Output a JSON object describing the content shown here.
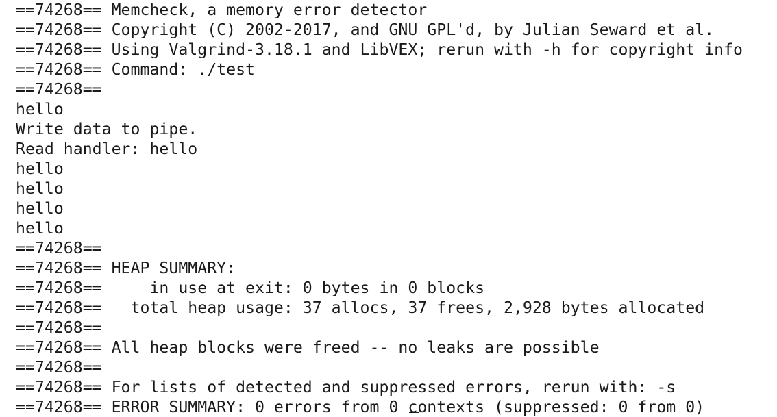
{
  "terminal": {
    "lines": [
      "==74268== Memcheck, a memory error detector",
      "==74268== Copyright (C) 2002-2017, and GNU GPL'd, by Julian Seward et al.",
      "==74268== Using Valgrind-3.18.1 and LibVEX; rerun with -h for copyright info",
      "==74268== Command: ./test",
      "==74268==",
      "hello",
      "Write data to pipe.",
      "Read handler: hello",
      "hello",
      "hello",
      "hello",
      "hello",
      "==74268==",
      "==74268== HEAP SUMMARY:",
      "==74268==     in use at exit: 0 bytes in 0 blocks",
      "==74268==   total heap usage: 37 allocs, 37 frees, 2,928 bytes allocated",
      "==74268==",
      "==74268== All heap blocks were freed -- no leaks are possible",
      "==74268==",
      "==74268== For lists of detected and suppressed errors, rerun with: -s",
      "==74268== ERROR SUMMARY: 0 errors from 0 contexts (suppressed: 0 from 0)"
    ]
  }
}
